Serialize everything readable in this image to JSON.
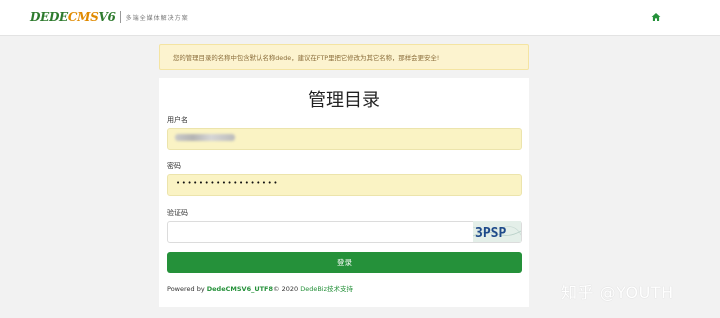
{
  "header": {
    "logo_prefix": "DEDE",
    "logo_cms": "CMS",
    "logo_suffix": "V6",
    "logo_slogan": "多端全媒体解决方案",
    "home_icon": "home-icon"
  },
  "alert": {
    "message": "您的管理目录的名称中包含默认名称dede，建议在FTP里把它修改为其它名称，那样会更安全!"
  },
  "form": {
    "title": "管理目录",
    "username_label": "用户名",
    "password_label": "密码",
    "password_mask": "••••••••••••••••••",
    "captcha_label": "验证码",
    "captcha_value": "",
    "captcha_text": "3PSP",
    "submit_label": "登录"
  },
  "footer": {
    "powered_by": "Powered by ",
    "product": "DedeCMSV6_UTF8",
    "copyright": "© 2020 ",
    "vendor": "DedeBiz",
    "support": "技术支持"
  },
  "watermark": "知乎 @YOUTH",
  "colors": {
    "brand_green": "#25913a",
    "alert_bg": "#fcf3cf",
    "autofill_bg": "#faf3c4"
  }
}
